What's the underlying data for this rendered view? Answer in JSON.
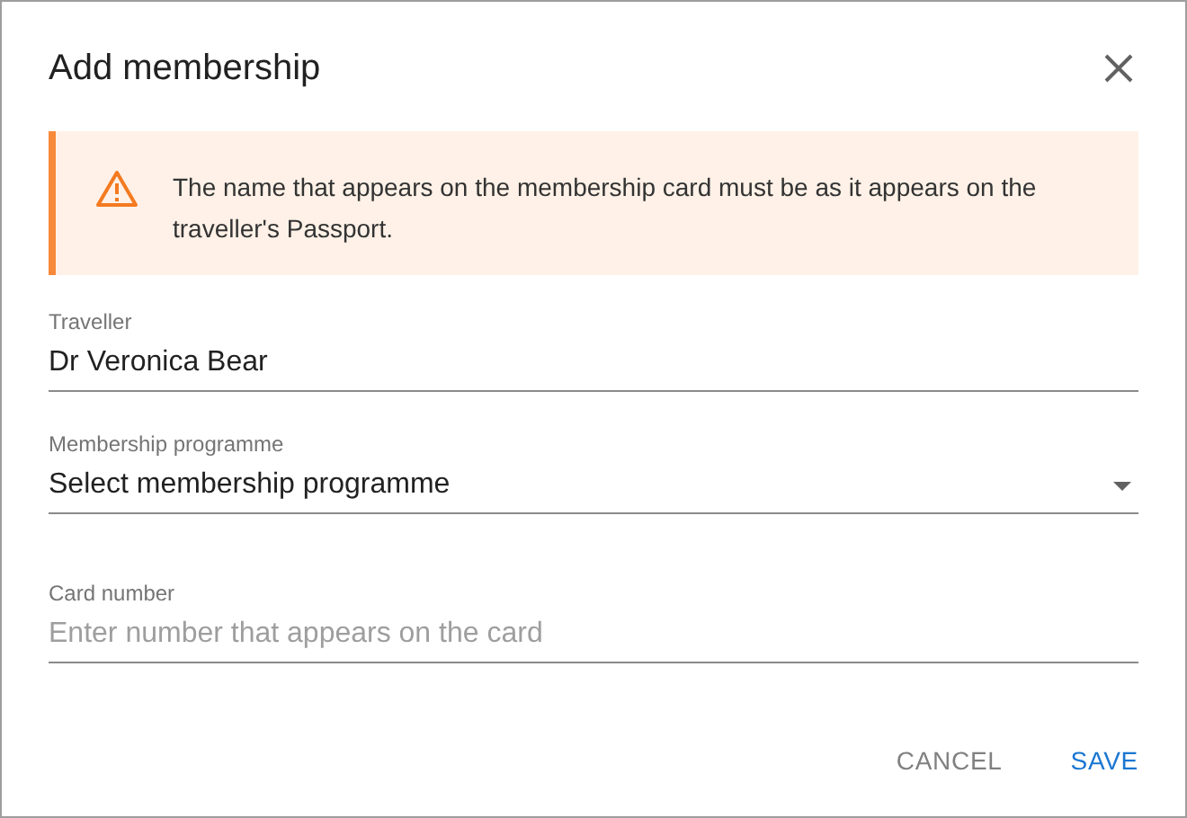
{
  "dialog": {
    "title": "Add membership"
  },
  "alert": {
    "kind": "warning",
    "text": "The name that appears on the membership card must be as it appears on the traveller's Passport."
  },
  "fields": [
    {
      "kind": "text",
      "label": "Traveller",
      "value": "Dr Veronica Bear"
    },
    {
      "kind": "select",
      "label": "Membership programme",
      "value": "Select membership programme"
    },
    {
      "kind": "text",
      "label": "Card number",
      "placeholder": "Enter number that appears on the card"
    }
  ],
  "buttons": [
    {
      "label": "CANCEL",
      "kind": "secondary"
    },
    {
      "label": "SAVE",
      "kind": "primary"
    }
  ]
}
